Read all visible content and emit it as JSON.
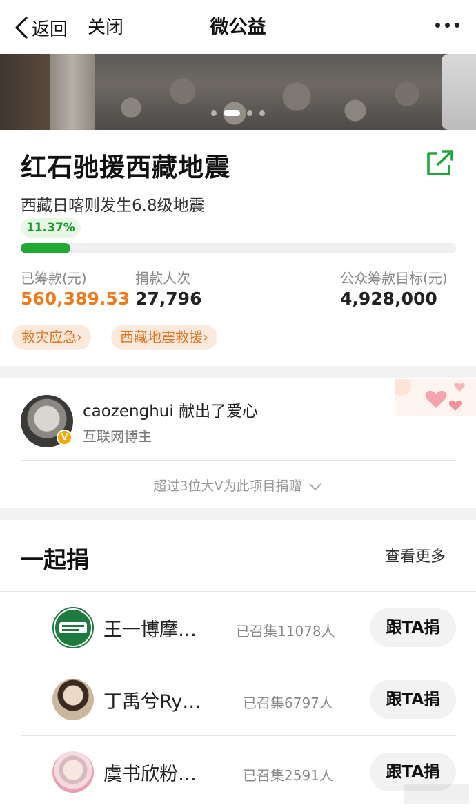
{
  "nav": {
    "back_label": "返回",
    "close_label": "关闭",
    "title": "微公益"
  },
  "banner": {
    "slide_count": 4,
    "active_slide": 2
  },
  "project": {
    "title": "红石驰援西藏地震",
    "subtitle": "西藏日喀则发生6.8级地震",
    "progress_label": "11.37%",
    "progress_fraction": 0.1137,
    "stats": [
      {
        "label": "已筹款(元)",
        "value": "560,389.53"
      },
      {
        "label": "捐款人次",
        "value": "27,796"
      },
      {
        "label": "公众筹款目标(元)",
        "value": "4,928,000"
      }
    ],
    "tags": [
      "救灾应急›",
      "西藏地震救援›"
    ]
  },
  "donor": {
    "name_line": "caozenghui 献出了爱心",
    "role": "互联网博主",
    "more_label": "超过3位大V为此项目捐赠"
  },
  "together": {
    "title": "一起捐",
    "see_more": "查看更多",
    "rows": [
      {
        "name": "王一博摩…",
        "count": "已召集11078人",
        "button": "跟TA捐"
      },
      {
        "name": "丁禹兮Ry…",
        "count": "已召集6797人",
        "button": "跟TA捐"
      },
      {
        "name": "虞书欣粉…",
        "count": "已召集2591人",
        "button": "跟TA捐"
      }
    ]
  },
  "colors": {
    "accent_green": "#21a834",
    "accent_orange": "#f07a19",
    "tag_bg": "#fbe9dc"
  },
  "icons": {
    "back": "chevron-left-icon",
    "more": "more-dots-icon",
    "share": "share-external-icon",
    "verified": "verified-v-icon",
    "expand": "chevron-down-icon"
  }
}
